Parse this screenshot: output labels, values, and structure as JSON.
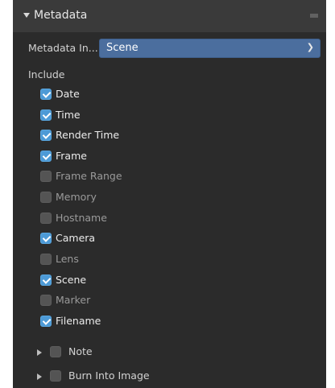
{
  "panel": {
    "title": "Metadata",
    "collapse_icon": "triangle-down-icon",
    "grip_icon": "drag-grip-icon"
  },
  "metadata_input": {
    "label": "Metadata In...",
    "value": "Scene",
    "chevron_icon": "chevron-down-icon"
  },
  "include": {
    "label": "Include",
    "items": [
      {
        "label": "Date",
        "checked": true
      },
      {
        "label": "Time",
        "checked": true
      },
      {
        "label": "Render Time",
        "checked": true
      },
      {
        "label": "Frame",
        "checked": true
      },
      {
        "label": "Frame Range",
        "checked": false
      },
      {
        "label": "Memory",
        "checked": false
      },
      {
        "label": "Hostname",
        "checked": false
      },
      {
        "label": "Camera",
        "checked": true
      },
      {
        "label": "Lens",
        "checked": false
      },
      {
        "label": "Scene",
        "checked": true
      },
      {
        "label": "Marker",
        "checked": false
      },
      {
        "label": "Filename",
        "checked": true
      }
    ]
  },
  "subpanels": [
    {
      "label": "Note",
      "checked": false,
      "expand_icon": "triangle-right-icon"
    },
    {
      "label": "Burn Into Image",
      "checked": false,
      "expand_icon": "triangle-right-icon"
    }
  ],
  "colors": {
    "panel_bg": "#2b2b2b",
    "header_bg": "#3a3a3a",
    "accent": "#4b6e9e",
    "checkbox_on": "#4d9ad6",
    "checkbox_off": "#545454"
  }
}
